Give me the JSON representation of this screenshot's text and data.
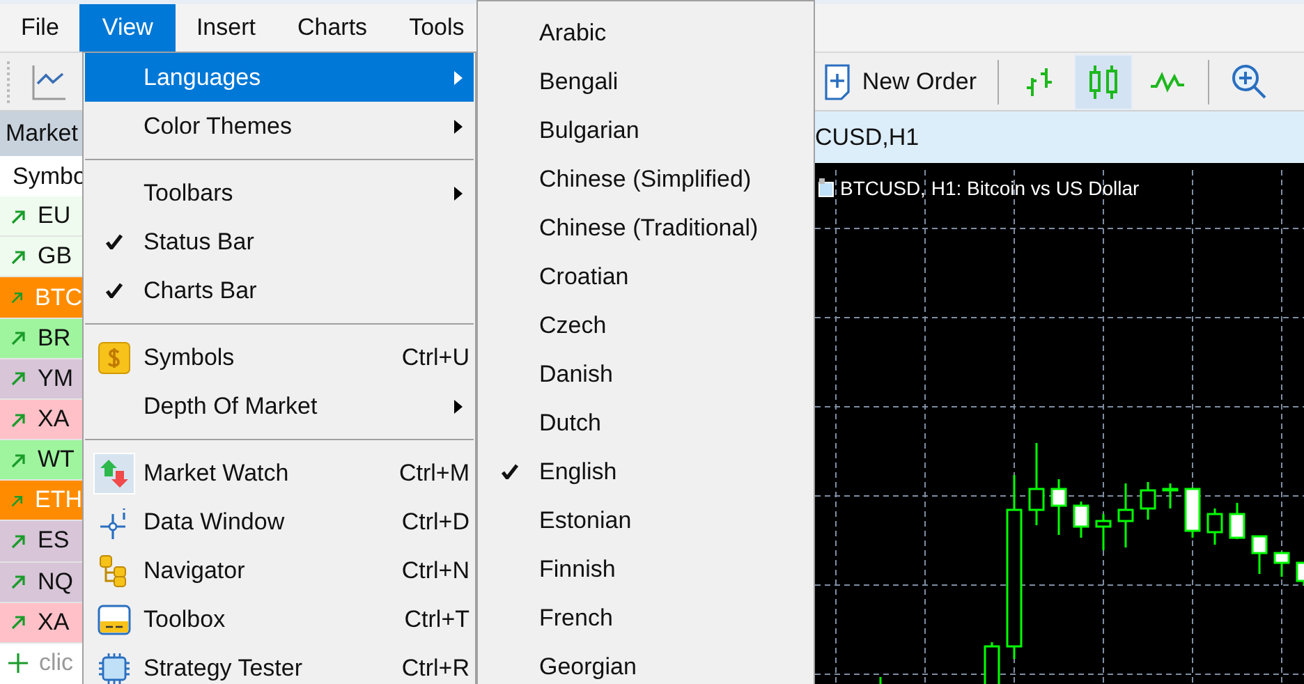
{
  "menu_bar": [
    {
      "label": "File",
      "selected": false
    },
    {
      "label": "View",
      "selected": true
    },
    {
      "label": "Insert",
      "selected": false
    },
    {
      "label": "Charts",
      "selected": false
    },
    {
      "label": "Tools",
      "selected": false
    }
  ],
  "toolbar": {
    "new_order": "New Order",
    "chart_types": [
      {
        "kind": "bars",
        "selected": false
      },
      {
        "kind": "candles",
        "selected": true
      },
      {
        "kind": "line",
        "selected": false
      }
    ]
  },
  "market_watch": {
    "title": "Market",
    "column": "Symbo",
    "rows": [
      {
        "symbol": "EU",
        "color": "#eefbee"
      },
      {
        "symbol": "GB",
        "color": "#eefbee"
      },
      {
        "symbol": "BTC",
        "color": "#ff8c00"
      },
      {
        "symbol": "BR",
        "color": "#9ef59e"
      },
      {
        "symbol": "YM",
        "color": "#d8c5d8"
      },
      {
        "symbol": "XA",
        "color": "#ffc0c8"
      },
      {
        "symbol": "WT",
        "color": "#9ef59e"
      },
      {
        "symbol": "ETH",
        "color": "#ff8c00"
      },
      {
        "symbol": "ES",
        "color": "#d8c5d8"
      },
      {
        "symbol": "NQ",
        "color": "#d8c5d8"
      },
      {
        "symbol": "XA",
        "color": "#ffc0c8"
      }
    ],
    "add_row": "clic"
  },
  "chart_window": {
    "title": "CUSD,H1",
    "label": "BTCUSD, H1:  Bitcoin vs US Dollar"
  },
  "view_menu": [
    {
      "kind": "submenu",
      "label": "Languages",
      "selected": true
    },
    {
      "kind": "submenu",
      "label": "Color Themes",
      "selected": false
    },
    {
      "kind": "separator"
    },
    {
      "kind": "submenu",
      "label": "Toolbars",
      "selected": false
    },
    {
      "kind": "toggle",
      "label": "Status Bar",
      "checked": true,
      "selected": false
    },
    {
      "kind": "toggle",
      "label": "Charts Bar",
      "checked": true,
      "selected": false
    },
    {
      "kind": "separator"
    },
    {
      "kind": "symbols",
      "label": "Symbols",
      "shortcut": "Ctrl+U",
      "checked": false,
      "selected": false
    },
    {
      "kind": "submenu",
      "label": "Depth Of Market",
      "selected": false
    },
    {
      "kind": "separator"
    },
    {
      "kind": "watch",
      "label": "Market Watch",
      "shortcut": "Ctrl+M",
      "checked": true,
      "selected": false
    },
    {
      "kind": "data",
      "label": "Data Window",
      "shortcut": "Ctrl+D",
      "checked": false,
      "selected": false
    },
    {
      "kind": "navigator",
      "label": "Navigator",
      "shortcut": "Ctrl+N",
      "checked": false,
      "selected": false
    },
    {
      "kind": "toolbox",
      "label": "Toolbox",
      "shortcut": "Ctrl+T",
      "checked": false,
      "selected": false
    },
    {
      "kind": "tester",
      "label": "Strategy Tester",
      "shortcut": "Ctrl+R",
      "checked": false,
      "selected": false
    }
  ],
  "languages_menu": [
    {
      "label": "Arabic",
      "checked": false
    },
    {
      "label": "Bengali",
      "checked": false
    },
    {
      "label": "Bulgarian",
      "checked": false
    },
    {
      "label": "Chinese (Simplified)",
      "checked": false
    },
    {
      "label": "Chinese (Traditional)",
      "checked": false
    },
    {
      "label": "Croatian",
      "checked": false
    },
    {
      "label": "Czech",
      "checked": false
    },
    {
      "label": "Danish",
      "checked": false
    },
    {
      "label": "Dutch",
      "checked": false
    },
    {
      "label": "English",
      "checked": true
    },
    {
      "label": "Estonian",
      "checked": false
    },
    {
      "label": "Finnish",
      "checked": false
    },
    {
      "label": "French",
      "checked": false
    },
    {
      "label": "Georgian",
      "checked": false
    }
  ]
}
